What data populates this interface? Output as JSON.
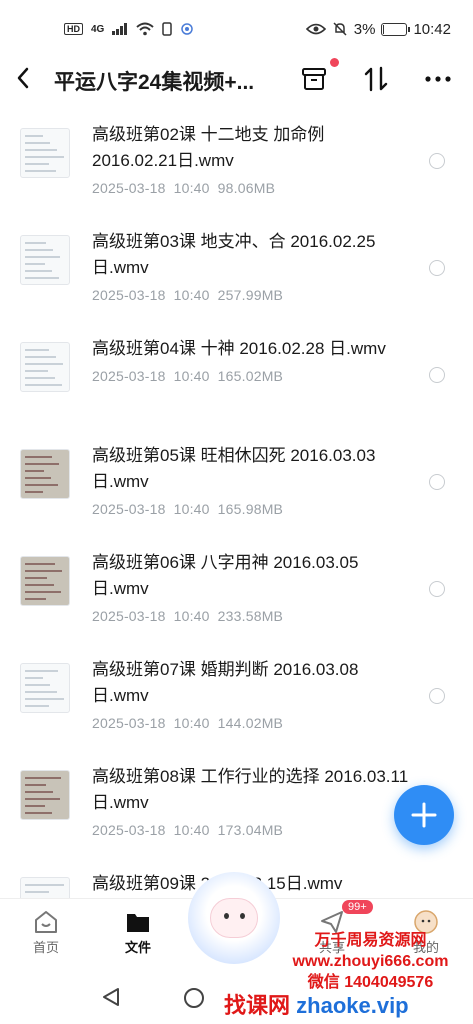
{
  "status_bar": {
    "hd": "HD",
    "network": "4G",
    "battery": "3%",
    "battery_level": 0.03,
    "time": "10:42"
  },
  "header": {
    "title": "平运八字24集视频+...",
    "icons": [
      "back-icon",
      "archive-icon",
      "sort-icon",
      "more-icon"
    ]
  },
  "files": [
    {
      "name": "高级班第02课 十二地支 加命例 2016.02.21日.wmv",
      "date": "2025-03-18",
      "time": "10:40",
      "size": "98.06MB",
      "thumb": "light"
    },
    {
      "name": "高级班第03课 地支冲、合 2016.02.25日.wmv",
      "date": "2025-03-18",
      "time": "10:40",
      "size": "257.99MB",
      "thumb": "light"
    },
    {
      "name": "高级班第04课 十神 2016.02.28 日.wmv",
      "date": "2025-03-18",
      "time": "10:40",
      "size": "165.02MB",
      "thumb": "light"
    },
    {
      "name": "高级班第05课 旺相休囚死 2016.03.03日.wmv",
      "date": "2025-03-18",
      "time": "10:40",
      "size": "165.98MB",
      "thumb": "dark"
    },
    {
      "name": "高级班第06课  八字用神 2016.03.05 日.wmv",
      "date": "2025-03-18",
      "time": "10:40",
      "size": "233.58MB",
      "thumb": "dark"
    },
    {
      "name": "高级班第07课  婚期判断 2016.03.08 日.wmv",
      "date": "2025-03-18",
      "time": "10:40",
      "size": "144.02MB",
      "thumb": "light"
    },
    {
      "name": "高级班第08课 工作行业的选择 2016.03.11日.wmv",
      "date": "2025-03-18",
      "time": "10:40",
      "size": "173.04MB",
      "thumb": "dark"
    },
    {
      "name": "高级班第09课 2016.03.15日.wmv",
      "date": "",
      "time": "",
      "size": "",
      "thumb": "light"
    }
  ],
  "bottom_nav": {
    "home": "首页",
    "files": "文件",
    "share": "共享",
    "mine": "我的",
    "badge": "99+"
  },
  "watermark": {
    "line1": "万千周易资源网",
    "line2": "www.zhouyi666.com",
    "line3": "微信 1404049576",
    "brand_cn": "找课网",
    "brand_url": "zhaoke.vip"
  },
  "colors": {
    "accent": "#2f8df5",
    "badge": "#f0455a",
    "watermark_red": "#e01818",
    "watermark_blue": "#1e6fd9"
  }
}
